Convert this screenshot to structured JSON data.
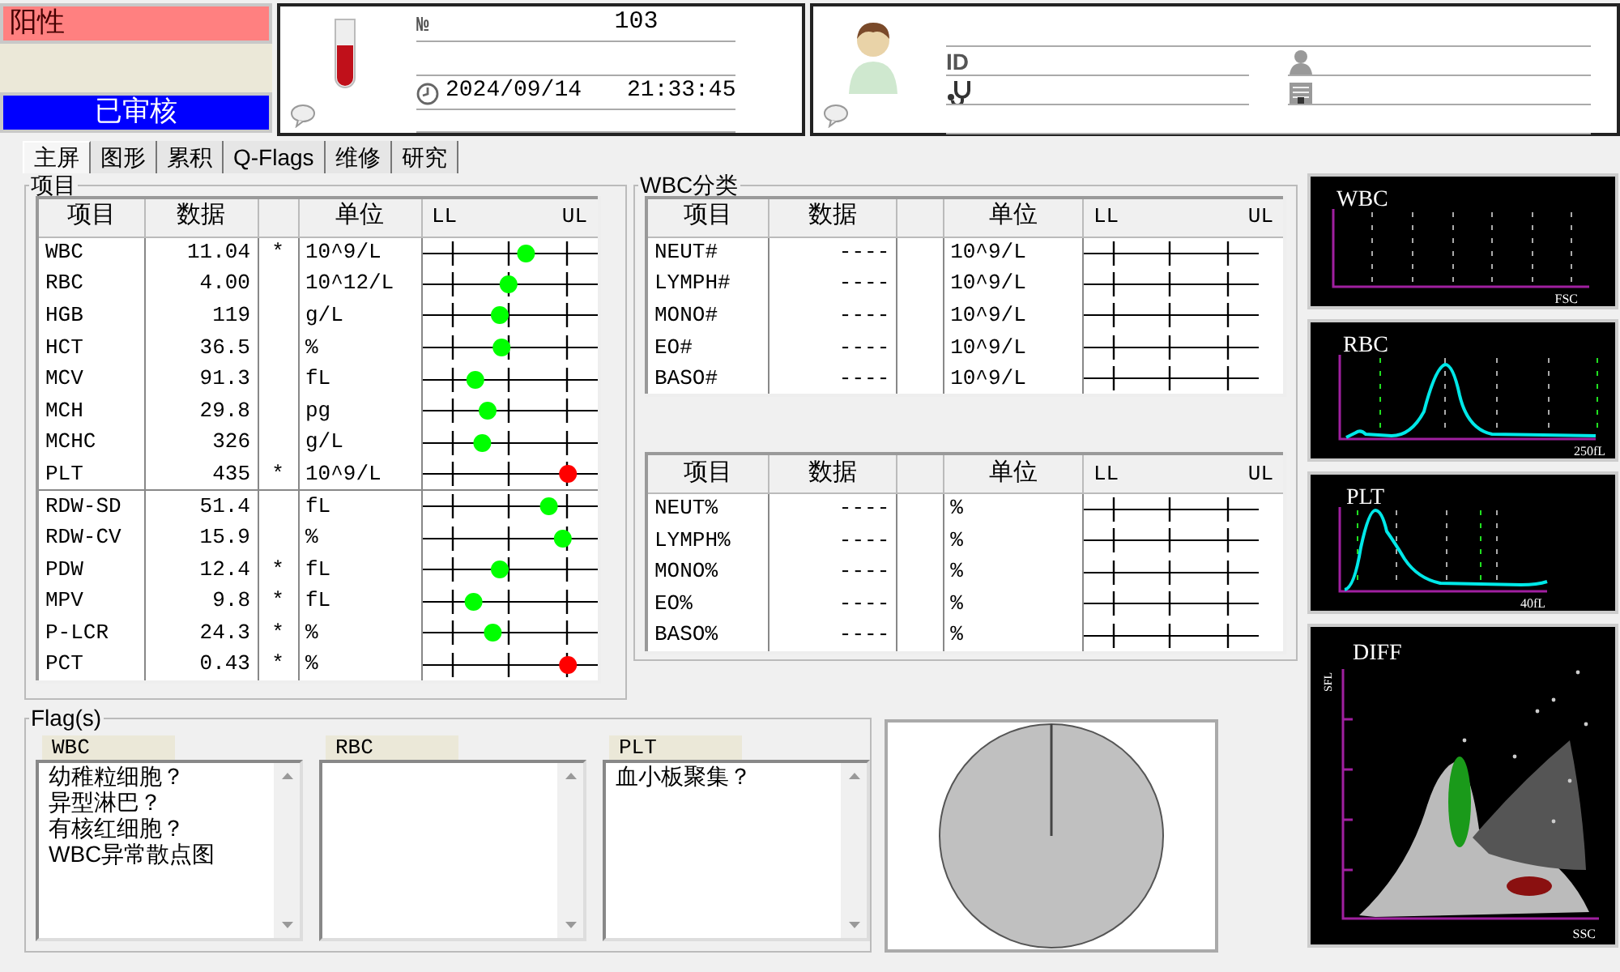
{
  "status": {
    "result": "阳性",
    "review": "已审核"
  },
  "sample": {
    "number_label": "№",
    "number": "103",
    "date": "2024/09/14",
    "time": "21:33:45"
  },
  "patient": {
    "id_label": "ID"
  },
  "tabs": [
    {
      "label": "主屏",
      "selected": true
    },
    {
      "label": "图形",
      "selected": false
    },
    {
      "label": "累积",
      "selected": false
    },
    {
      "label": "Q-Flags",
      "selected": false
    },
    {
      "label": "维修",
      "selected": false
    },
    {
      "label": "研究",
      "selected": false
    }
  ],
  "results_panel": {
    "title": "项目",
    "columns": [
      "项目",
      "数据",
      "单位"
    ],
    "ll": "LL",
    "ul": "UL",
    "groups": [
      [
        {
          "name": "WBC",
          "value": "11.04",
          "flag": "*",
          "unit": "10^9/L",
          "level": 0.59,
          "color": "#00ff00"
        },
        {
          "name": "RBC",
          "value": "4.00",
          "unit": "10^12/L",
          "level": 0.49,
          "color": "#00ff00"
        },
        {
          "name": "HGB",
          "value": "119",
          "unit": "g/L",
          "level": 0.44,
          "color": "#00ff00"
        },
        {
          "name": "HCT",
          "value": "36.5",
          "unit": "%",
          "level": 0.45,
          "color": "#00ff00"
        },
        {
          "name": "MCV",
          "value": "91.3",
          "unit": "fL",
          "level": 0.3,
          "color": "#00ff00"
        },
        {
          "name": "MCH",
          "value": "29.8",
          "unit": "pg",
          "level": 0.37,
          "color": "#00ff00"
        },
        {
          "name": "MCHC",
          "value": "326",
          "unit": "g/L",
          "level": 0.34,
          "color": "#00ff00"
        },
        {
          "name": "PLT",
          "value": "435",
          "flag": "*",
          "unit": "10^9/L",
          "level": 0.83,
          "color": "#ff0000"
        }
      ],
      [
        {
          "name": "RDW-SD",
          "value": "51.4",
          "unit": "fL",
          "level": 0.72,
          "color": "#00ff00"
        },
        {
          "name": "RDW-CV",
          "value": "15.9",
          "unit": "%",
          "level": 0.8,
          "color": "#00ff00"
        },
        {
          "name": "PDW",
          "value": "12.4",
          "flag": "*",
          "unit": "fL",
          "level": 0.44,
          "color": "#00ff00"
        },
        {
          "name": "MPV",
          "value": "9.8",
          "flag": "*",
          "unit": "fL",
          "level": 0.29,
          "color": "#00ff00"
        },
        {
          "name": "P-LCR",
          "value": "24.3",
          "flag": "*",
          "unit": "%",
          "level": 0.4,
          "color": "#00ff00"
        },
        {
          "name": "PCT",
          "value": "0.43",
          "flag": "*",
          "unit": "%",
          "level": 0.83,
          "color": "#ff0000"
        }
      ]
    ]
  },
  "wbc_panel": {
    "title": "WBC分类",
    "tables": [
      {
        "columns": [
          "项目",
          "数据",
          "单位"
        ],
        "ll": "LL",
        "ul": "UL",
        "rows": [
          {
            "name": "NEUT#",
            "value": "----",
            "unit": "10^9/L"
          },
          {
            "name": "LYMPH#",
            "value": "----",
            "unit": "10^9/L"
          },
          {
            "name": "MONO#",
            "value": "----",
            "unit": "10^9/L"
          },
          {
            "name": "EO#",
            "value": "----",
            "unit": "10^9/L"
          },
          {
            "name": "BASO#",
            "value": "----",
            "unit": "10^9/L"
          }
        ]
      },
      {
        "columns": [
          "项目",
          "数据",
          "单位"
        ],
        "ll": "LL",
        "ul": "UL",
        "rows": [
          {
            "name": "NEUT%",
            "value": "----",
            "unit": "%"
          },
          {
            "name": "LYMPH%",
            "value": "----",
            "unit": "%"
          },
          {
            "name": "MONO%",
            "value": "----",
            "unit": "%"
          },
          {
            "name": "EO%",
            "value": "----",
            "unit": "%"
          },
          {
            "name": "BASO%",
            "value": "----",
            "unit": "%"
          }
        ]
      }
    ]
  },
  "flags": {
    "title": "Flag(s)",
    "lists": [
      {
        "title": "WBC",
        "items": [
          "幼稚粒细胞？",
          "异型淋巴？",
          "有核红细胞？",
          "WBC异常散点图"
        ]
      },
      {
        "title": "RBC"
      },
      {
        "title": "PLT",
        "items": [
          "血小板聚集？"
        ]
      }
    ]
  },
  "graphs": [
    {
      "kind": "blank",
      "title": "WBC",
      "x_label": "FSC"
    },
    {
      "kind": "rbc",
      "title": "RBC",
      "x_label": "250fL"
    },
    {
      "kind": "plt",
      "title": "PLT",
      "x_label": "40fL"
    },
    {
      "kind": "scatter",
      "title": "DIFF",
      "x_label": "SSC",
      "y_label": "SFL"
    }
  ]
}
